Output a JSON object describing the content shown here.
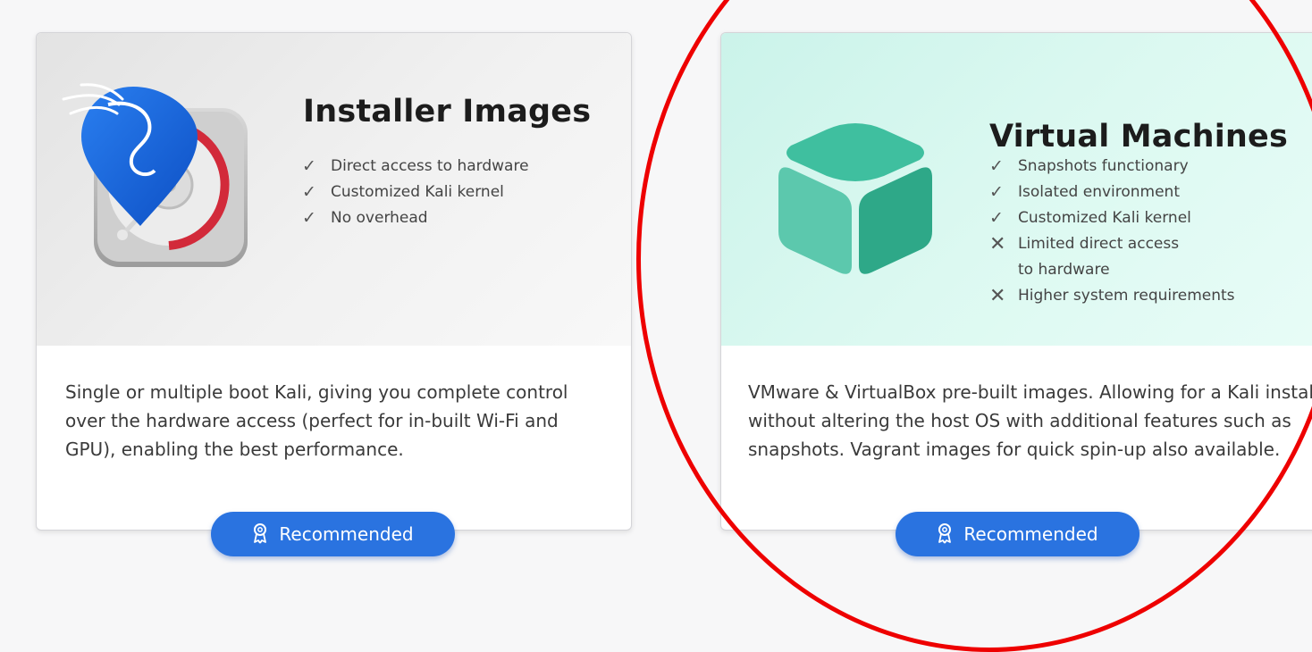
{
  "cards": [
    {
      "title": "Installer Images",
      "features": [
        {
          "type": "pro",
          "icon": "check-icon",
          "text": "Direct access to hardware"
        },
        {
          "type": "pro",
          "icon": "check-icon",
          "text": "Customized Kali kernel"
        },
        {
          "type": "pro",
          "icon": "check-icon",
          "text": "No overhead"
        }
      ],
      "description": "Single or multiple boot Kali, giving you complete control over the hardware access (perfect for in-built Wi-Fi and GPU), enabling the best performance.",
      "button_label": "Recommended",
      "banner_color": "#ececec",
      "image": "kali-installer-disk-icon"
    },
    {
      "title": "Virtual Machines",
      "features": [
        {
          "type": "pro",
          "icon": "check-icon",
          "text": "Snapshots functionary"
        },
        {
          "type": "pro",
          "icon": "check-icon",
          "text": "Isolated environment"
        },
        {
          "type": "pro",
          "icon": "check-icon",
          "text": "Customized Kali kernel"
        },
        {
          "type": "con",
          "icon": "cross-icon",
          "text": "Limited direct access to hardware"
        },
        {
          "type": "con",
          "icon": "cross-icon",
          "text": "Higher system requirements"
        }
      ],
      "description": "VMware & VirtualBox pre-built images. Allowing for a Kali install without altering the host OS with additional features such as snapshots. Vagrant images for quick spin-up also available.",
      "button_label": "Recommended",
      "banner_color": "#d8f7f0",
      "image": "virtual-machine-cube-icon"
    }
  ],
  "symbols": {
    "check": "✓",
    "cross": "✕"
  },
  "colors": {
    "button": "#2a73e0",
    "annotation": "#ee0000",
    "cube_light": "#3fbf9f",
    "cube_dark": "#2ea888"
  }
}
